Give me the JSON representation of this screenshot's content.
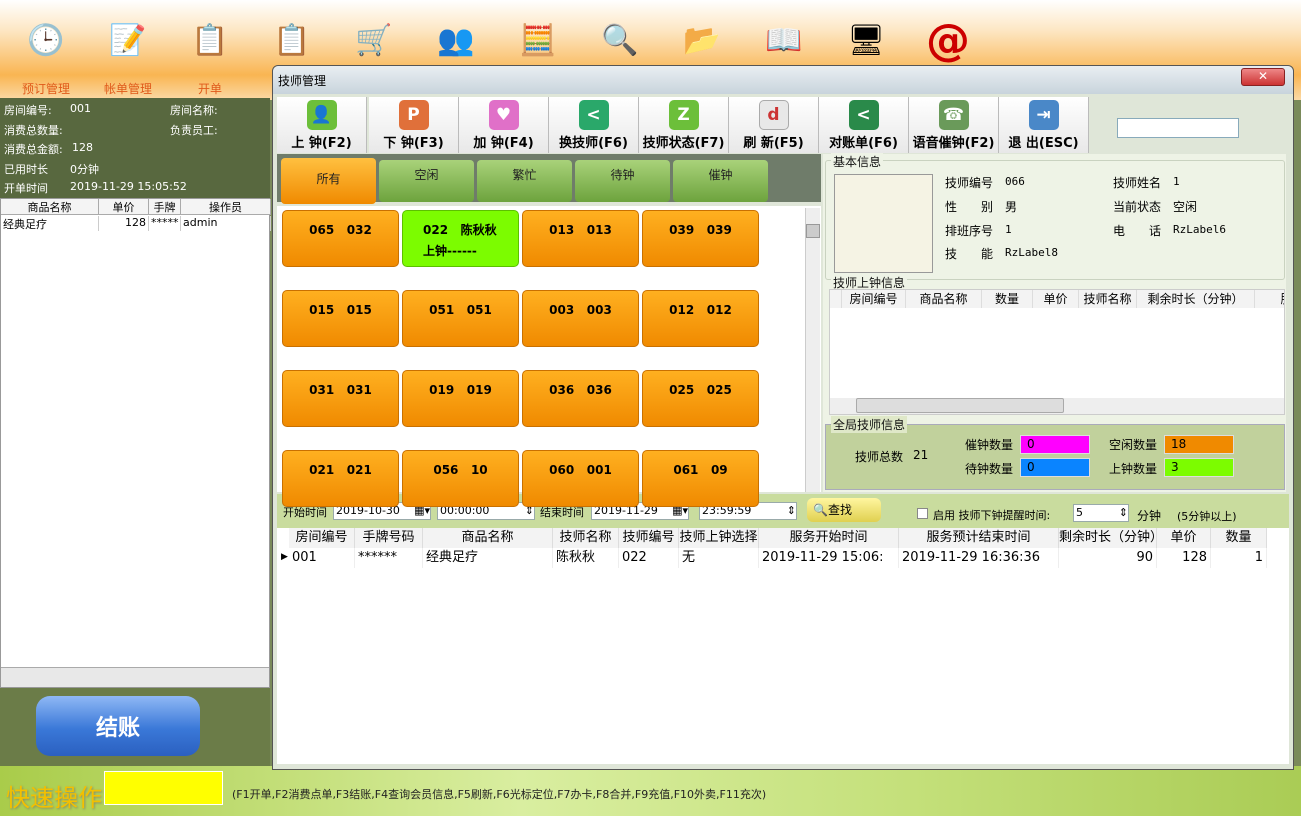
{
  "topbar": {
    "icons": [
      {
        "name": "clock-icon",
        "glyph": "🕒",
        "label": "预订管理"
      },
      {
        "name": "memo-icon",
        "glyph": "📝",
        "label": "帐单管理"
      },
      {
        "name": "clipboard-icon",
        "glyph": "📋",
        "label": "开单"
      },
      {
        "name": "clipboard-icon",
        "glyph": "📋",
        "label": ""
      },
      {
        "name": "cart-icon",
        "glyph": "🛒",
        "label": ""
      },
      {
        "name": "users-icon",
        "glyph": "👥",
        "label": ""
      },
      {
        "name": "calculator-icon",
        "glyph": "🧮",
        "label": ""
      },
      {
        "name": "search-doc-icon",
        "glyph": "🔍",
        "label": ""
      },
      {
        "name": "folder-icon",
        "glyph": "📂",
        "label": ""
      },
      {
        "name": "book-icon",
        "glyph": "📖",
        "label": ""
      },
      {
        "name": "finder-icon",
        "glyph": "🖥",
        "label": ""
      },
      {
        "name": "at-icon",
        "glyph": "@",
        "label": ""
      }
    ]
  },
  "left": {
    "room_no_label": "房间编号:",
    "room_no": "001",
    "room_name_label": "房间名称:",
    "total_qty_label": "消费总数量:",
    "staff_label": "负责员工:",
    "total_amount_label": "消费总金额:",
    "total_amount": "128",
    "used_time_label": "已用时长",
    "used_time": "0分钟",
    "open_time_label": "开单时间",
    "open_time": "2019-11-29 15:05:52",
    "table": {
      "headers": [
        "商品名称",
        "单价",
        "手牌号",
        "操作员"
      ],
      "rows": [
        [
          "经典足疗",
          "128",
          "*****",
          "admin"
        ]
      ]
    },
    "pay_button": "结账"
  },
  "bottom": {
    "quick_label": "快速操作",
    "quick_input": "",
    "hint": "(F1开单,F2消费点单,F3结账,F4查询会员信息,F5刷新,F6光标定位,F7办卡,F8合并,F9充值,F10外卖,F11充次)"
  },
  "dialog": {
    "title": "技师管理",
    "close": "✕",
    "toolbar": [
      {
        "label": "上 钟(F2)",
        "icon": "person-icon",
        "glyph": "👤",
        "color": "#6cbf3a"
      },
      {
        "label": "下 钟(F3)",
        "icon": "parking-icon",
        "glyph": "P",
        "color": "#e0703a"
      },
      {
        "label": "加 钟(F4)",
        "icon": "heart-icon",
        "glyph": "♥",
        "color": "#e070c8"
      },
      {
        "label": "换技师(F6)",
        "icon": "share-icon",
        "glyph": "<",
        "color": "#2aa86a"
      },
      {
        "label": "技师状态(F7)",
        "icon": "status-icon",
        "glyph": "Z",
        "color": "#6cbf3a"
      },
      {
        "label": "刷 新(F5)",
        "icon": "refresh-icon",
        "glyph": "d",
        "color": "#e8e8e8"
      },
      {
        "label": "对账单(F6)",
        "icon": "share-icon",
        "glyph": "<",
        "color": "#2a8a4a"
      },
      {
        "label": "语音催钟(F2)",
        "icon": "voice-icon",
        "glyph": "☎",
        "color": "#6a9a5a"
      },
      {
        "label": "退 出(ESC)",
        "icon": "exit-icon",
        "glyph": "⇥",
        "color": "#4a88c8"
      }
    ],
    "search_value": "",
    "filter_tabs": [
      "所有",
      "空闲",
      "繁忙",
      "待钟",
      "催钟"
    ],
    "active_filter": "所有",
    "cards": [
      {
        "line1": "065   032",
        "line2": "",
        "busy": false
      },
      {
        "line1": "022   陈秋秋",
        "line2": "上钟------",
        "busy": true
      },
      {
        "line1": "013   013",
        "line2": "",
        "busy": false
      },
      {
        "line1": "039   039",
        "line2": "",
        "busy": false
      },
      {
        "line1": "015   015",
        "line2": "",
        "busy": false
      },
      {
        "line1": "051   051",
        "line2": "",
        "busy": false
      },
      {
        "line1": "003   003",
        "line2": "",
        "busy": false
      },
      {
        "line1": "012   012",
        "line2": "",
        "busy": false
      },
      {
        "line1": "031   031",
        "line2": "",
        "busy": false
      },
      {
        "line1": "019   019",
        "line2": "",
        "busy": false
      },
      {
        "line1": "036   036",
        "line2": "",
        "busy": false
      },
      {
        "line1": "025   025",
        "line2": "",
        "busy": false
      },
      {
        "line1": "021   021",
        "line2": "",
        "busy": false
      },
      {
        "line1": "056   10",
        "line2": "",
        "busy": false
      },
      {
        "line1": "060   001",
        "line2": "",
        "busy": false
      },
      {
        "line1": "061   09",
        "line2": "",
        "busy": false
      }
    ],
    "basic": {
      "title": "基本信息",
      "no_label": "技师编号",
      "no": "066",
      "name_label": "技师姓名",
      "name": "1",
      "gender_label": "性　　别",
      "gender": "男",
      "state_label": "当前状态",
      "state": "空闲",
      "order_label": "排班序号",
      "order": "1",
      "phone_label": "电　　话",
      "phone": "RzLabel6",
      "skill_label": "技　　能",
      "skill": "RzLabel8"
    },
    "oncall": {
      "title": "技师上钟信息",
      "headers": [
        "房间编号",
        "商品名称",
        "数量",
        "单价",
        "技师名称",
        "剩余时长（分钟）",
        "服务开始"
      ]
    },
    "global": {
      "title": "全局技师信息",
      "total_label": "技师总数",
      "total": "21",
      "urge_label": "催钟数量",
      "urge": "0",
      "urge_color": "#ff00ff",
      "idle_label": "空闲数量",
      "idle": "18",
      "idle_color": "#f08a00",
      "wait_label": "待钟数量",
      "wait": "0",
      "wait_color": "#0a84ff",
      "busy_label": "上钟数量",
      "busy": "3",
      "busy_color": "#7cfc00"
    },
    "query": {
      "start_label": "开始时间",
      "start_date": "2019-10-30",
      "start_time": "00:00:00",
      "end_label": "结束时间",
      "end_date": "2019-11-29",
      "end_time": "23:59:59",
      "search": "查找",
      "remind_label": "启用 技师下钟提醒时间:",
      "remind_value": "5",
      "remind_unit": "分钟",
      "remind_note": "(5分钟以上)"
    },
    "records": {
      "headers": [
        "房间编号",
        "手牌号码",
        "商品名称",
        "技师名称",
        "技师编号",
        "技师上钟选择",
        "服务开始时间",
        "服务预计结束时间",
        "剩余时长（分钟）",
        "单价",
        "数量"
      ],
      "rows": [
        [
          "001",
          "******",
          "经典足疗",
          "陈秋秋",
          "022",
          "无",
          "2019-11-29 15:06:",
          "2019-11-29 16:36:36",
          "90",
          "128",
          "1"
        ]
      ]
    }
  }
}
